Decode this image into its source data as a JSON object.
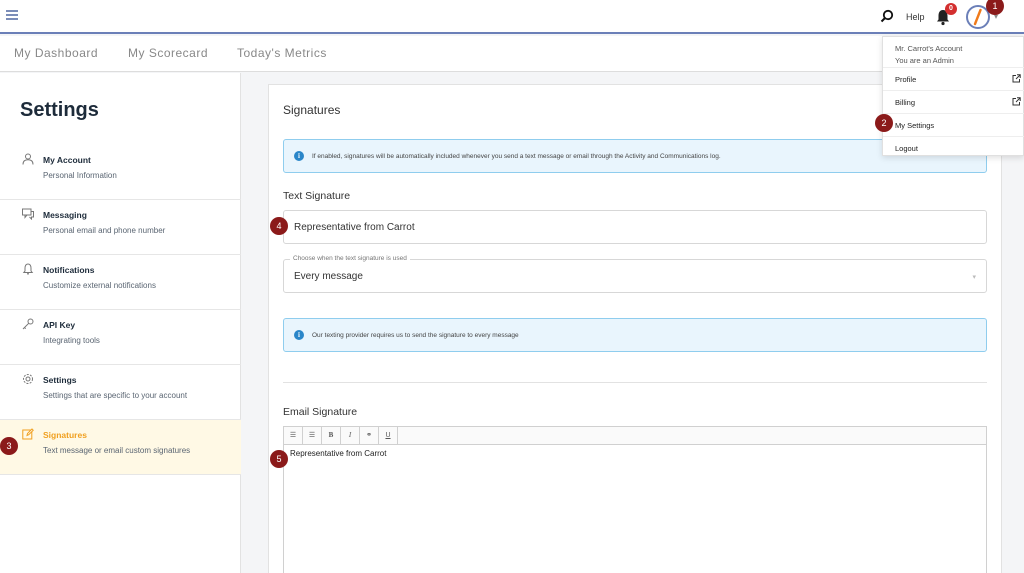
{
  "topbar": {
    "help_label": "Help",
    "notification_count": "0",
    "icons": [
      "menu-icon",
      "search-icon",
      "bell-icon",
      "avatar",
      "chevron-down-icon"
    ]
  },
  "nav": {
    "tabs": [
      {
        "label": "My Dashboard"
      },
      {
        "label": "My Scorecard"
      },
      {
        "label": "Today's Metrics"
      }
    ]
  },
  "sidebar": {
    "title": "Settings",
    "items": [
      {
        "label": "My Account",
        "sub": "Personal Information",
        "icon": "user-icon"
      },
      {
        "label": "Messaging",
        "sub": "Personal email and phone number",
        "icon": "chat-icon"
      },
      {
        "label": "Notifications",
        "sub": "Customize external notifications",
        "icon": "bell-icon"
      },
      {
        "label": "API Key",
        "sub": "Integrating tools",
        "icon": "key-icon"
      },
      {
        "label": "Settings",
        "sub": "Settings that are specific to your account",
        "icon": "gear-icon"
      },
      {
        "label": "Signatures",
        "sub": "Text message or email custom signatures",
        "icon": "edit-icon"
      }
    ],
    "active_index": 5
  },
  "main": {
    "title": "Signatures",
    "info_top": "If enabled, signatures will be automatically included whenever you send a text message or email through the Activity and Communications log.",
    "text_signature_label": "Text Signature",
    "text_signature_value": "Representative from Carrot",
    "select_legend": "Choose when the text signature is used",
    "select_value": "Every message",
    "info_provider": "Our texting provider requires us to send the signature to every message",
    "email_signature_label": "Email Signature",
    "toolbar_buttons": [
      "☰",
      "☰",
      "B",
      "I",
      "⚭",
      "U"
    ],
    "email_signature_value": "Representative from Carrot"
  },
  "dropdown": {
    "account_name": "Mr. Carrot's Account",
    "role": "You are an Admin",
    "items": [
      {
        "label": "Profile"
      },
      {
        "label": "Billing"
      },
      {
        "label": "My Settings"
      },
      {
        "label": "Logout"
      }
    ]
  },
  "markers": [
    "1",
    "2",
    "3",
    "4",
    "5"
  ],
  "colors": {
    "accent": "#6b7fb8",
    "active_text": "#f0a020",
    "active_bg": "#fff9e5",
    "info_bg": "#e9f5fd",
    "info_border": "#8fcdee",
    "badge": "#d32f2f",
    "marker": "#8b1a1a"
  }
}
